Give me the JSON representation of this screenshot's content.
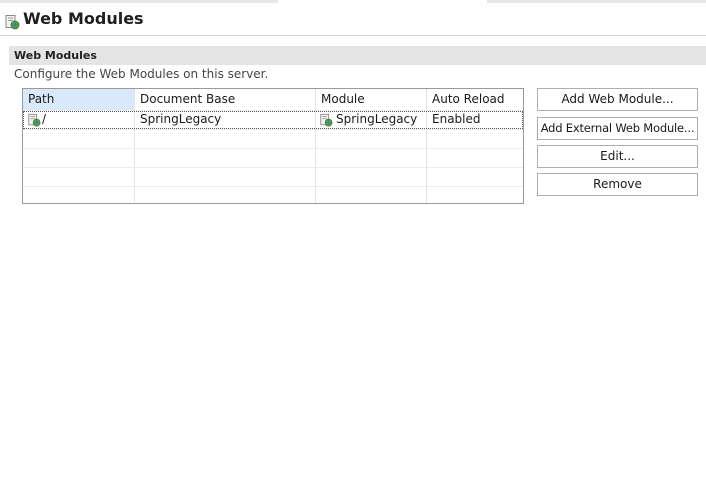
{
  "page": {
    "title": "Web Modules",
    "icon": "web-module-icon"
  },
  "section": {
    "title": "Web Modules",
    "description": "Configure the Web Modules on this server."
  },
  "table": {
    "columns": [
      "Path",
      "Document Base",
      "Module",
      "Auto Reload"
    ],
    "sorted_column": "Path",
    "rows": [
      {
        "path": "/",
        "document_base": "SpringLegacy",
        "module": "SpringLegacy",
        "auto_reload": "Enabled",
        "selected": true
      }
    ]
  },
  "buttons": {
    "add_web_module": "Add Web Module...",
    "add_external_web_module": "Add External Web Module...",
    "edit": "Edit...",
    "remove": "Remove"
  },
  "colors": {
    "section_bar": "#e4e4e4",
    "sorted_header": "#d9e8fb",
    "icon_green": "#5aa13a",
    "icon_blue": "#3d78b8"
  }
}
